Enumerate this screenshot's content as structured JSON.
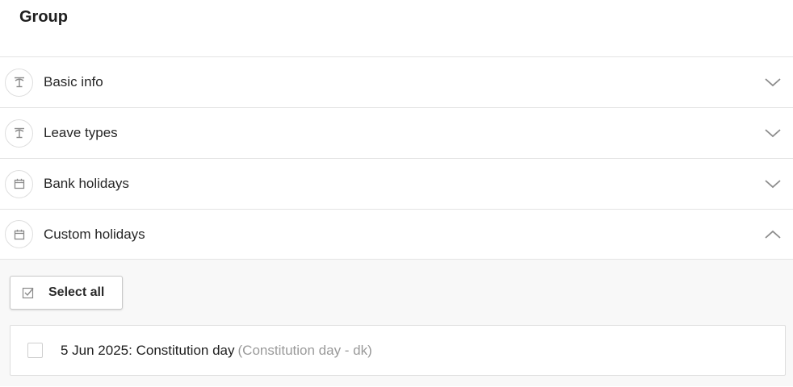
{
  "page": {
    "title": "Group"
  },
  "sections": [
    {
      "label": "Basic info",
      "icon": "palm-tree-icon",
      "expanded": false
    },
    {
      "label": "Leave types",
      "icon": "palm-tree-icon",
      "expanded": false
    },
    {
      "label": "Bank holidays",
      "icon": "calendar-icon",
      "expanded": false
    },
    {
      "label": "Custom holidays",
      "icon": "calendar-icon",
      "expanded": true
    }
  ],
  "custom_holidays": {
    "select_all_label": "Select all",
    "items": [
      {
        "date": "5 Jun 2025",
        "name": "Constitution day",
        "source": "(Constitution day - dk)",
        "checked": false
      }
    ]
  }
}
